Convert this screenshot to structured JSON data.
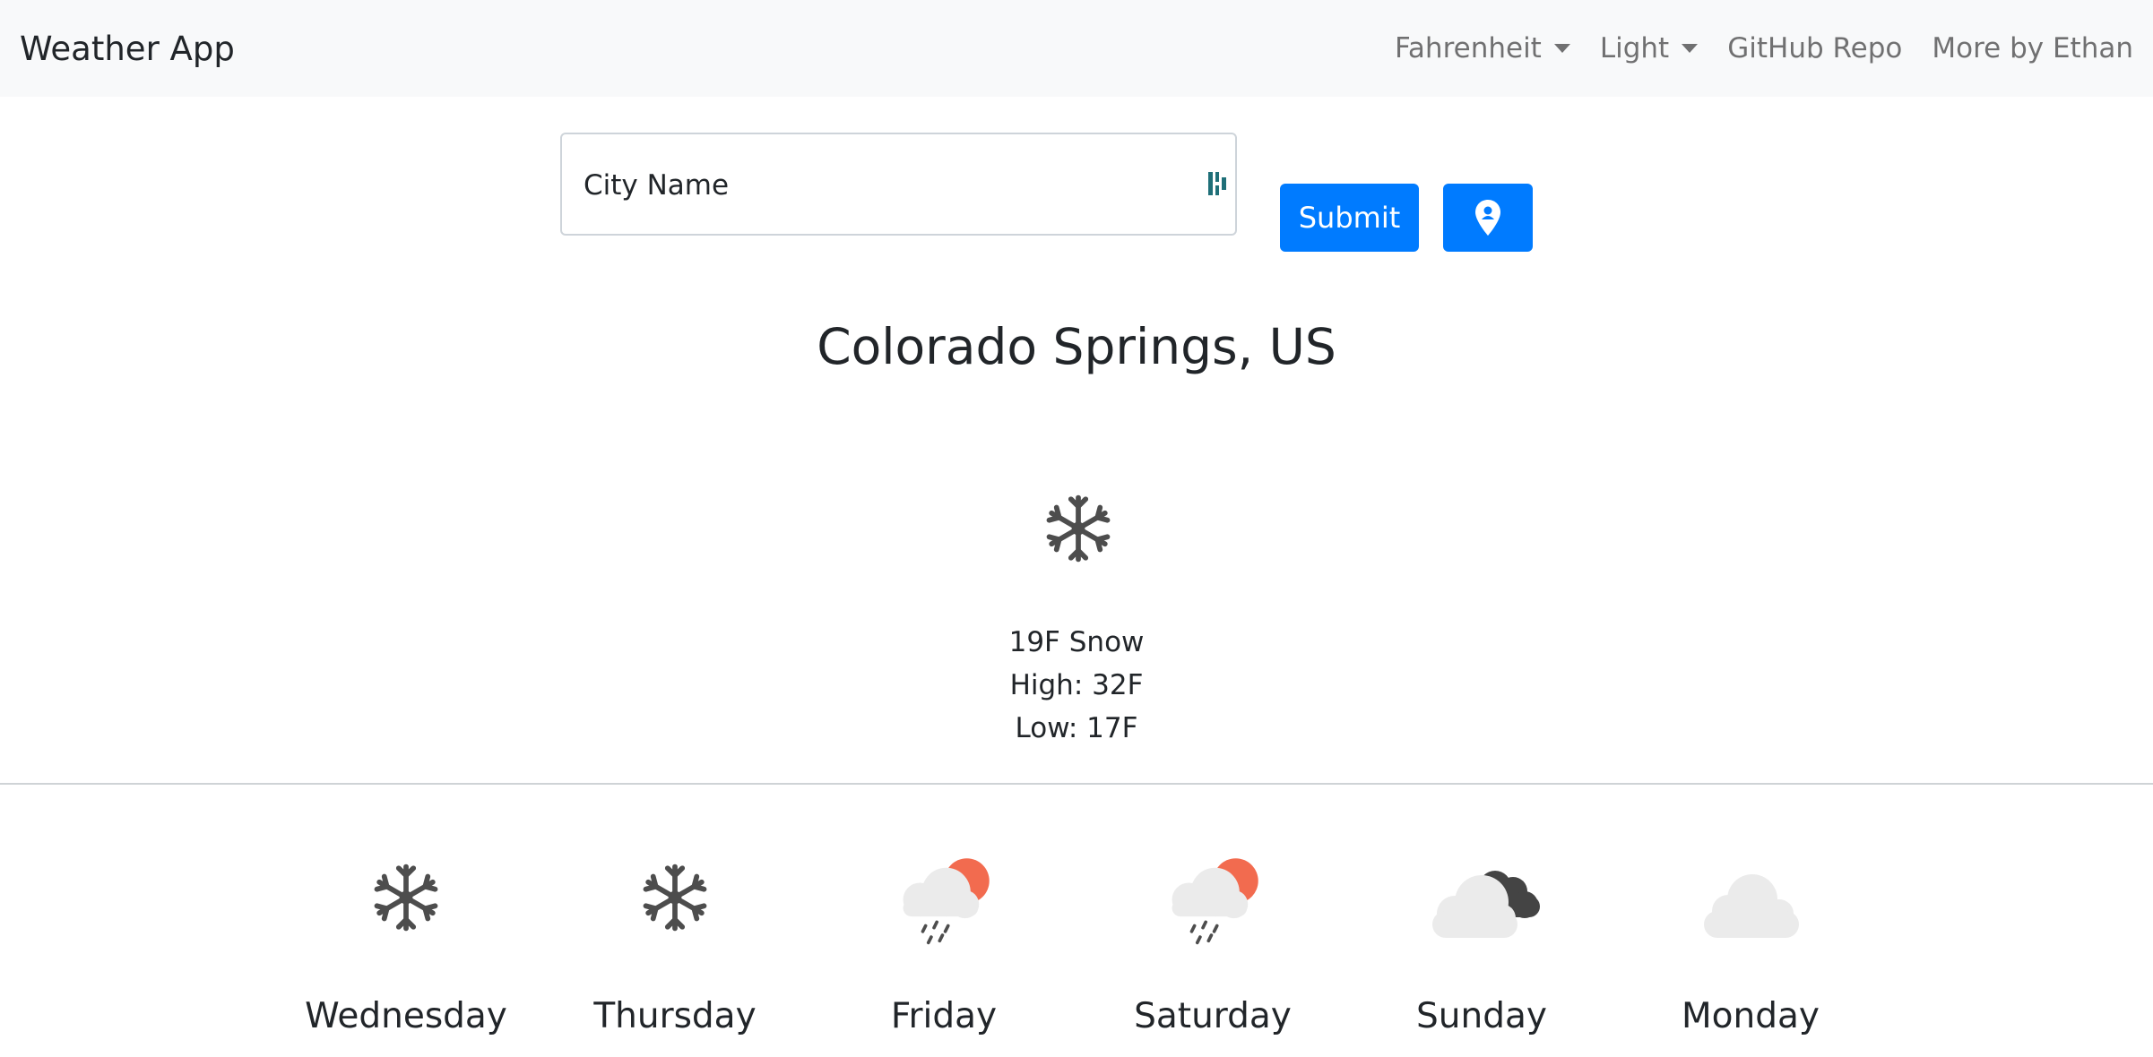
{
  "navbar": {
    "brand": "Weather App",
    "units_dropdown": "Fahrenheit",
    "theme_dropdown": "Light",
    "github_link": "GitHub Repo",
    "more_link": "More by Ethan"
  },
  "search": {
    "placeholder": "City Name",
    "value": "",
    "submit_label": "Submit",
    "locate_icon": "map-pin-icon"
  },
  "current": {
    "city": "Colorado Springs, US",
    "icon": "snowflake-icon",
    "summary": "19F Snow",
    "high": "High: 32F",
    "low": "Low: 17F"
  },
  "forecast": [
    {
      "day": "Wednesday",
      "icon": "snowflake-icon"
    },
    {
      "day": "Thursday",
      "icon": "snowflake-icon"
    },
    {
      "day": "Friday",
      "icon": "sun-cloud-rain-icon"
    },
    {
      "day": "Saturday",
      "icon": "sun-cloud-rain-icon"
    },
    {
      "day": "Sunday",
      "icon": "dark-cloud-icon"
    },
    {
      "day": "Monday",
      "icon": "cloud-icon"
    }
  ],
  "colors": {
    "primary": "#007bff",
    "navbar_bg": "#f8f9fa",
    "icon_dark": "#4a4a4a",
    "sun": "#f26b4f",
    "cloud_light": "#e8e8e8"
  }
}
